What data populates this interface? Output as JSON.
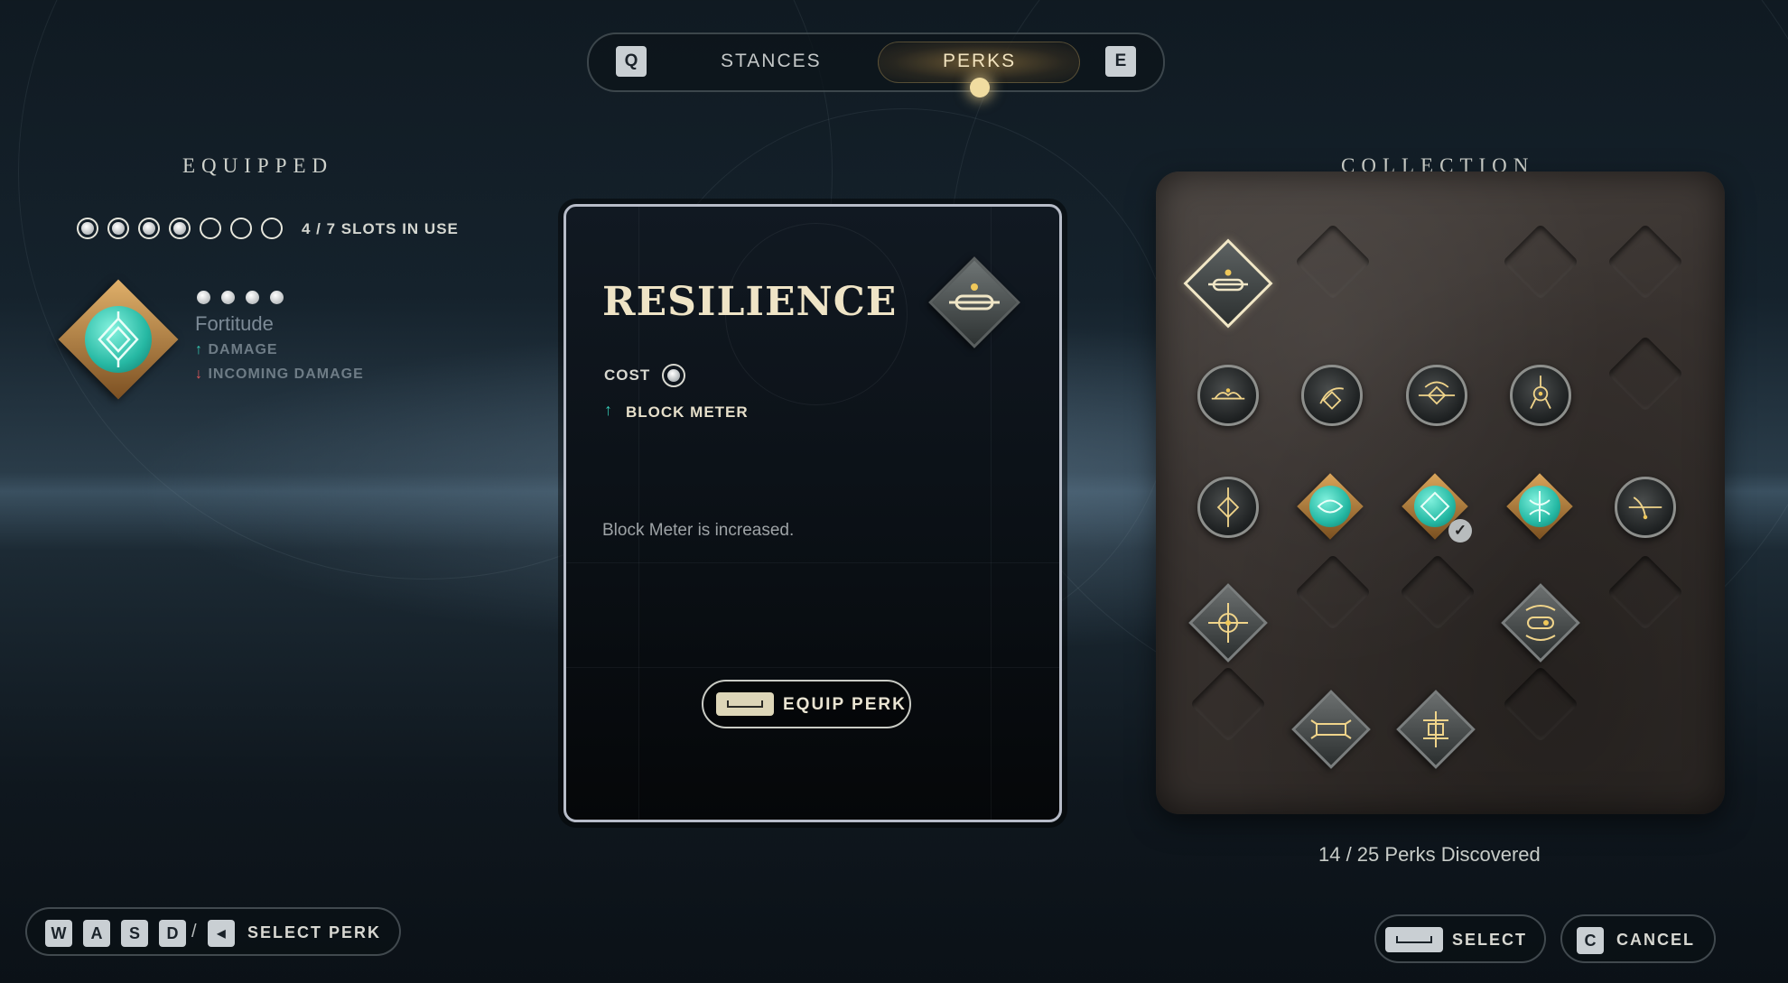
{
  "tabs": {
    "prev_key": "Q",
    "next_key": "E",
    "items": [
      {
        "label": "STANCES",
        "active": false
      },
      {
        "label": "PERKS",
        "active": true
      }
    ]
  },
  "equipped": {
    "heading": "EQUIPPED",
    "slots_text": "4 / 7 SLOTS IN USE",
    "slots_used": 4,
    "slots_total": 7,
    "perk": {
      "name": "Fortitude",
      "cost": 4,
      "effects": [
        {
          "direction": "up",
          "label": "DAMAGE",
          "color": "#35c7b2"
        },
        {
          "direction": "down",
          "label": "INCOMING DAMAGE",
          "color": "#e0575a"
        }
      ]
    }
  },
  "detail": {
    "title": "RESILIENCE",
    "cost_label": "COST",
    "cost": 1,
    "stat": {
      "direction": "up",
      "label": "BLOCK METER",
      "color": "#35c7b2"
    },
    "description": "Block Meter is increased.",
    "equip_button": "EQUIP PERK",
    "icon": "resilience-perk-icon"
  },
  "collection": {
    "heading": "COLLECTION",
    "discovered_text": "14 / 25 Perks Discovered",
    "discovered": 14,
    "total": 25
  },
  "footer": {
    "move_keys": [
      "W",
      "A",
      "S",
      "D"
    ],
    "move_separator": "/",
    "select_perk_label": "SELECT PERK",
    "select_label": "SELECT",
    "cancel_key": "C",
    "cancel_label": "CANCEL"
  },
  "colors": {
    "accent_gold": "#f0dca0",
    "teal": "#35c7b2",
    "red": "#e0575a"
  }
}
